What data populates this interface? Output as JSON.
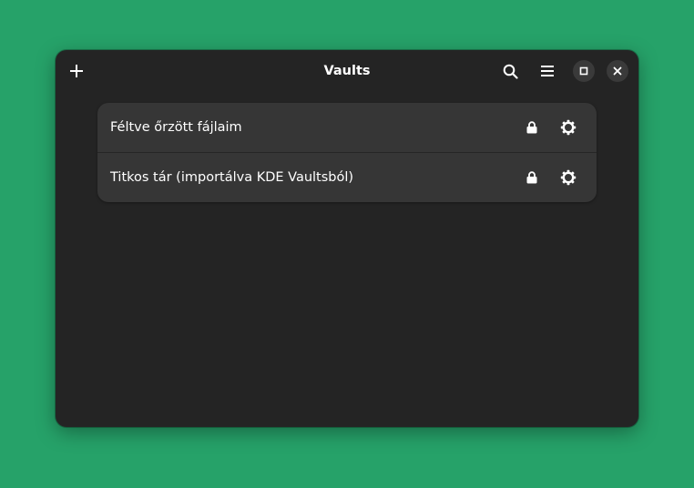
{
  "window": {
    "title": "Vaults"
  },
  "headerbar": {
    "add_icon": "plus-icon",
    "search_icon": "search-icon",
    "menu_icon": "hamburger-menu-icon",
    "maximize_icon": "maximize-icon",
    "close_icon": "close-icon"
  },
  "vaults": [
    {
      "name": "Féltve őrzött fájlaim",
      "lock_icon": "lock-icon",
      "settings_icon": "gear-icon"
    },
    {
      "name": "Titkos tár (importálva KDE Vaultsból)",
      "lock_icon": "lock-icon",
      "settings_icon": "gear-icon"
    }
  ],
  "colors": {
    "desktop_background": "#26a269",
    "window_background": "#242424",
    "list_background": "#363636",
    "text": "#ffffff"
  }
}
